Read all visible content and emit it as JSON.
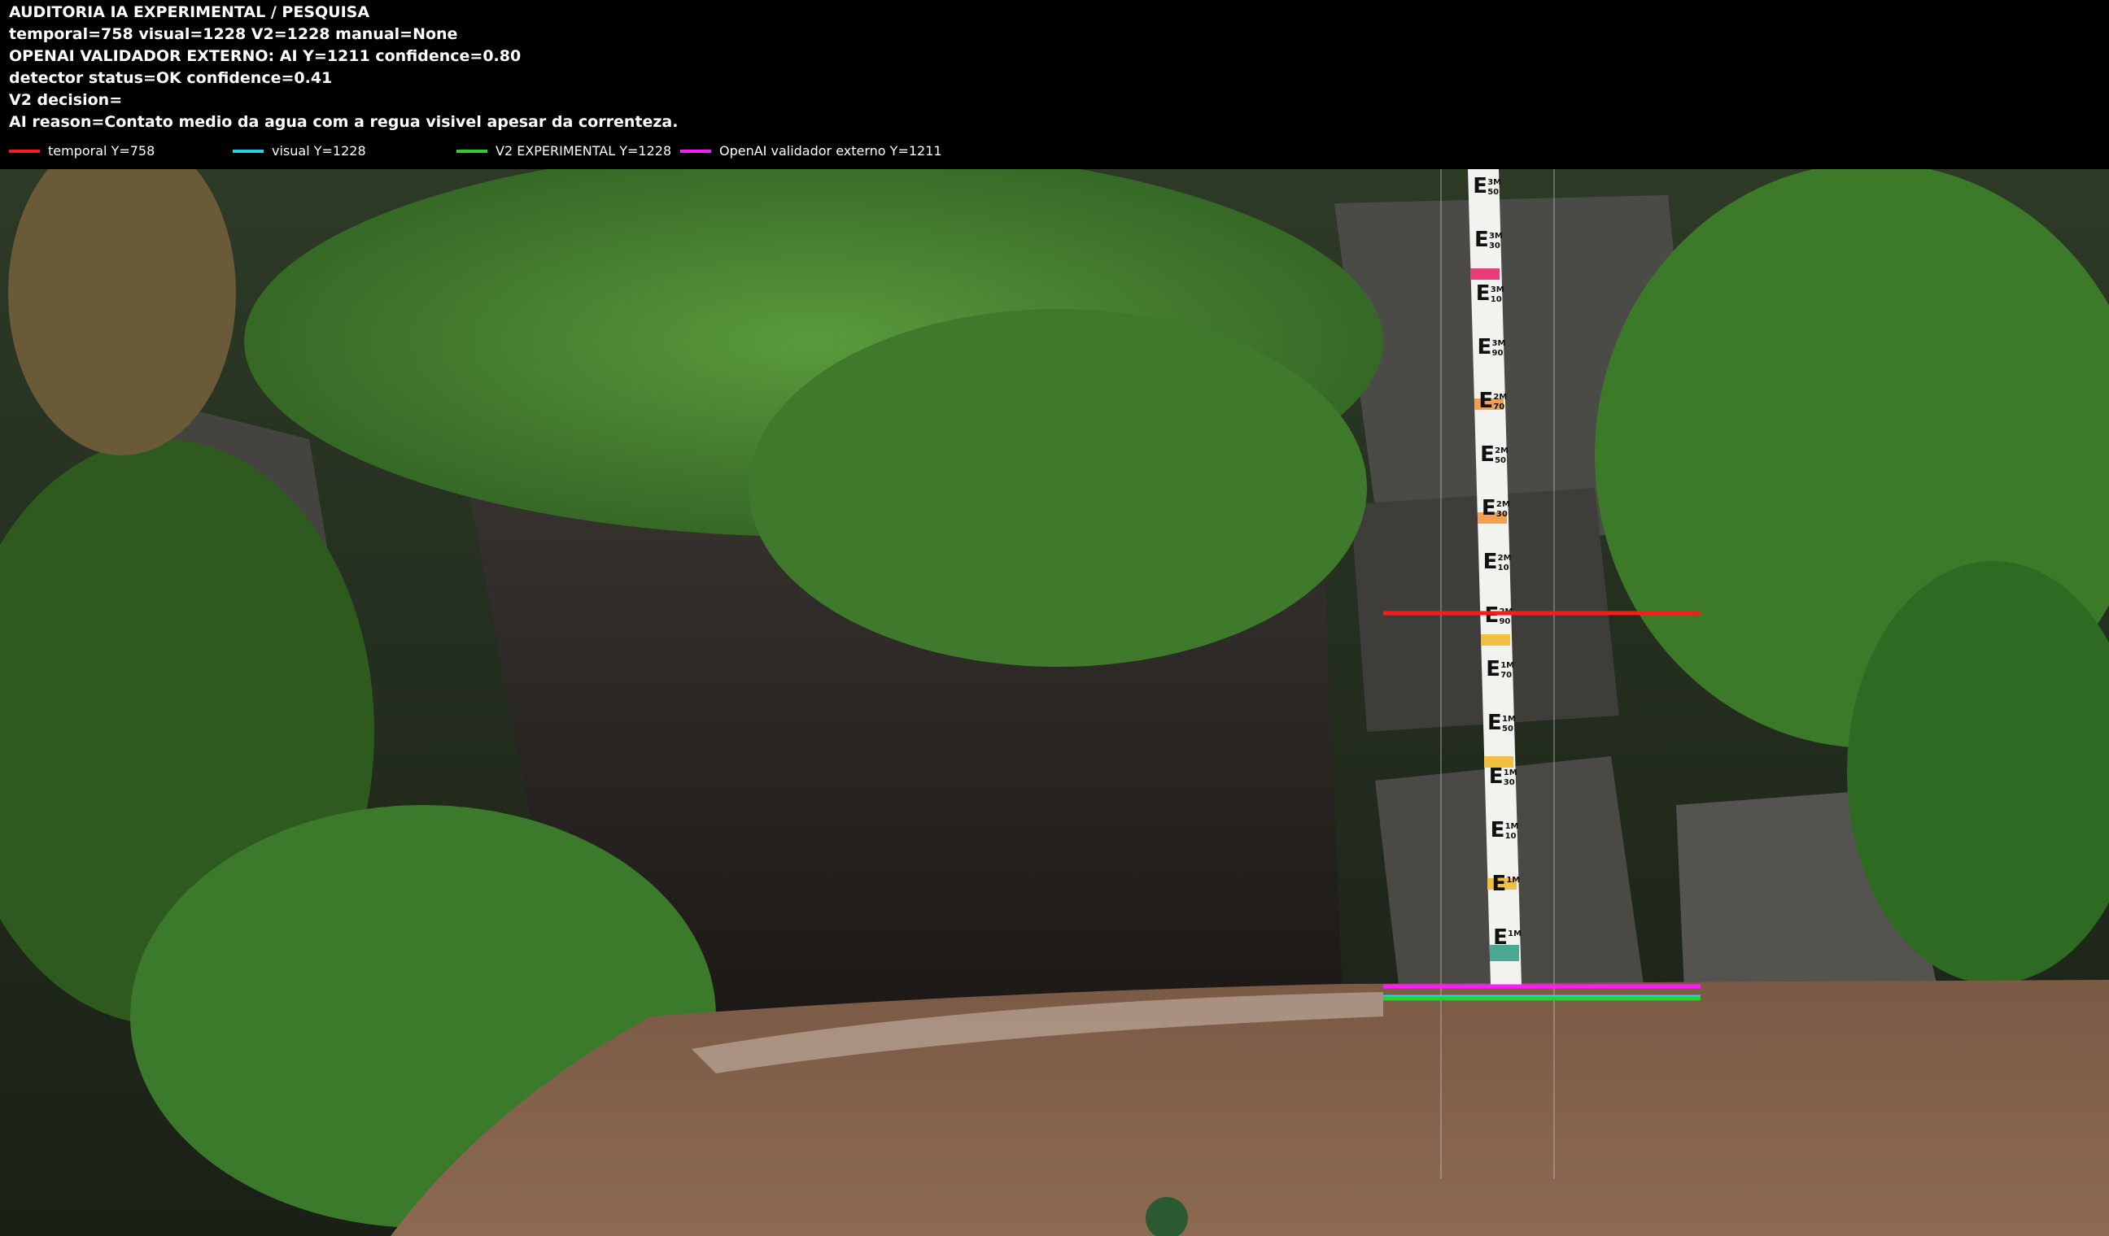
{
  "header": {
    "lines": [
      "AUDITORIA IA  EXPERIMENTAL / PESQUISA",
      "temporal=758  visual=1228  V2=1228  manual=None",
      "OPENAI  VALIDADOR EXTERNO: AI Y=1211  confidence=0.80",
      "detector status=OK confidence=0.41",
      "V2 decision=",
      "AI reason=Contato medio da agua com a regua visivel apesar da correnteza."
    ]
  },
  "legend": [
    {
      "label": "temporal Y=758",
      "color": "#ff1a1a"
    },
    {
      "label": "visual Y=1228",
      "color": "#22d3e6"
    },
    {
      "label": "V2 EXPERIMENTAL Y=1228",
      "color": "#2ad12a"
    },
    {
      "label": "OpenAI validador externo Y=1211",
      "color": "#ff1aff"
    }
  ],
  "gauge": {
    "labels": [
      "3M",
      "3M",
      "3M",
      "3M",
      "2M",
      "2M",
      "2M",
      "2M",
      "2M",
      "1M",
      "1M",
      "1M",
      "1M",
      "1M",
      "1M"
    ],
    "ticks": [
      "50",
      "30",
      "10",
      "90",
      "70",
      "50",
      "30",
      "10",
      "90",
      "70",
      "50",
      "30",
      "10"
    ]
  },
  "colors": {
    "temporal": "#ff1a1a",
    "visual": "#22d3e6",
    "v2": "#2ad12a",
    "openai": "#ff1aff"
  }
}
